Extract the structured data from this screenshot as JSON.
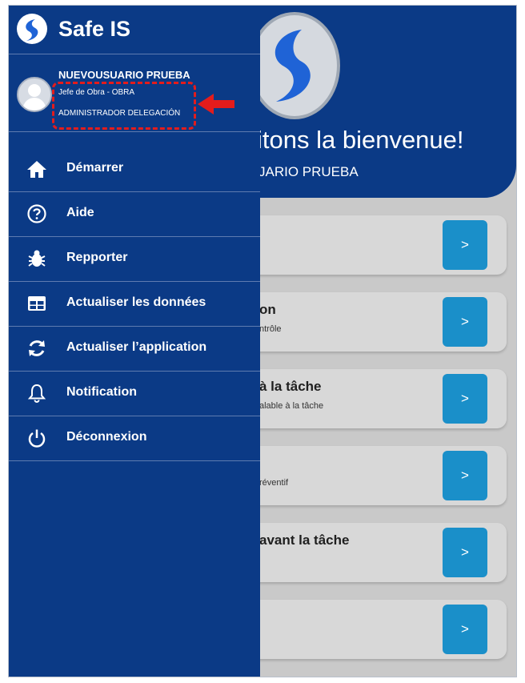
{
  "app": {
    "name": "Safe IS",
    "welcome_title": "itons la bienvenue!",
    "welcome_user": "JARIO PRUEBA"
  },
  "user": {
    "name": "NUEVOUSUARIO PRUEBA",
    "role": "Jefe de Obra - OBRA",
    "delegation": "ADMINISTRADOR DELEGACIÓN"
  },
  "menu": {
    "items": [
      {
        "label": "Démarrer",
        "icon": "home-icon"
      },
      {
        "label": "Aide",
        "icon": "help-icon"
      },
      {
        "label": "Repporter",
        "icon": "bug-icon"
      },
      {
        "label": "Actualiser les données",
        "icon": "table-icon"
      },
      {
        "label": "Actualiser l’application",
        "icon": "refresh-icon"
      },
      {
        "label": "Notification",
        "icon": "bell-icon"
      },
      {
        "label": "Déconnexion",
        "icon": "power-icon"
      }
    ]
  },
  "cards": [
    {
      "title": "",
      "subtitle": "",
      "button": ">"
    },
    {
      "title": "on",
      "subtitle": "ntrôle",
      "button": ">"
    },
    {
      "title": "à la tâche",
      "subtitle": "alable à la tâche",
      "button": ">"
    },
    {
      "title": "",
      "subtitle": "réventif",
      "button": ">"
    },
    {
      "title": "avant la tâche",
      "subtitle": "",
      "button": ">"
    },
    {
      "title": "",
      "subtitle": "",
      "button": ">"
    }
  ],
  "colors": {
    "drawer": "#0b3a86",
    "accent_button": "#1a8fc9",
    "annotation": "#e31c1c"
  }
}
